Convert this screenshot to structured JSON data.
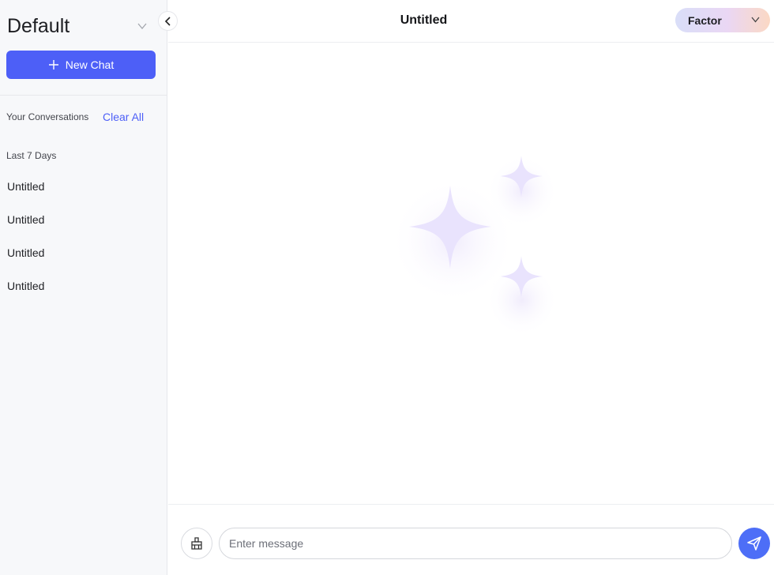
{
  "sidebar": {
    "workspace": "Default",
    "new_chat_label": "New Chat",
    "conversations_label": "Your Conversations",
    "clear_all_label": "Clear All",
    "group_label": "Last 7 Days",
    "items": [
      {
        "label": "Untitled"
      },
      {
        "label": "Untitled"
      },
      {
        "label": "Untitled"
      },
      {
        "label": "Untitled"
      }
    ]
  },
  "header": {
    "title": "Untitled",
    "model": "Factor"
  },
  "input": {
    "placeholder": "Enter message",
    "value": ""
  },
  "colors": {
    "accent": "#4d5ff7",
    "sidebar_bg": "#f7f8fa",
    "sparkle": "#e9e3fd"
  },
  "icons": {
    "collapse": "chevron-left-icon",
    "workspace_dropdown": "chevron-down-icon",
    "new_chat": "plus-icon",
    "empty_state": "sparkles-icon",
    "clean": "broom-icon",
    "send": "send-icon"
  }
}
